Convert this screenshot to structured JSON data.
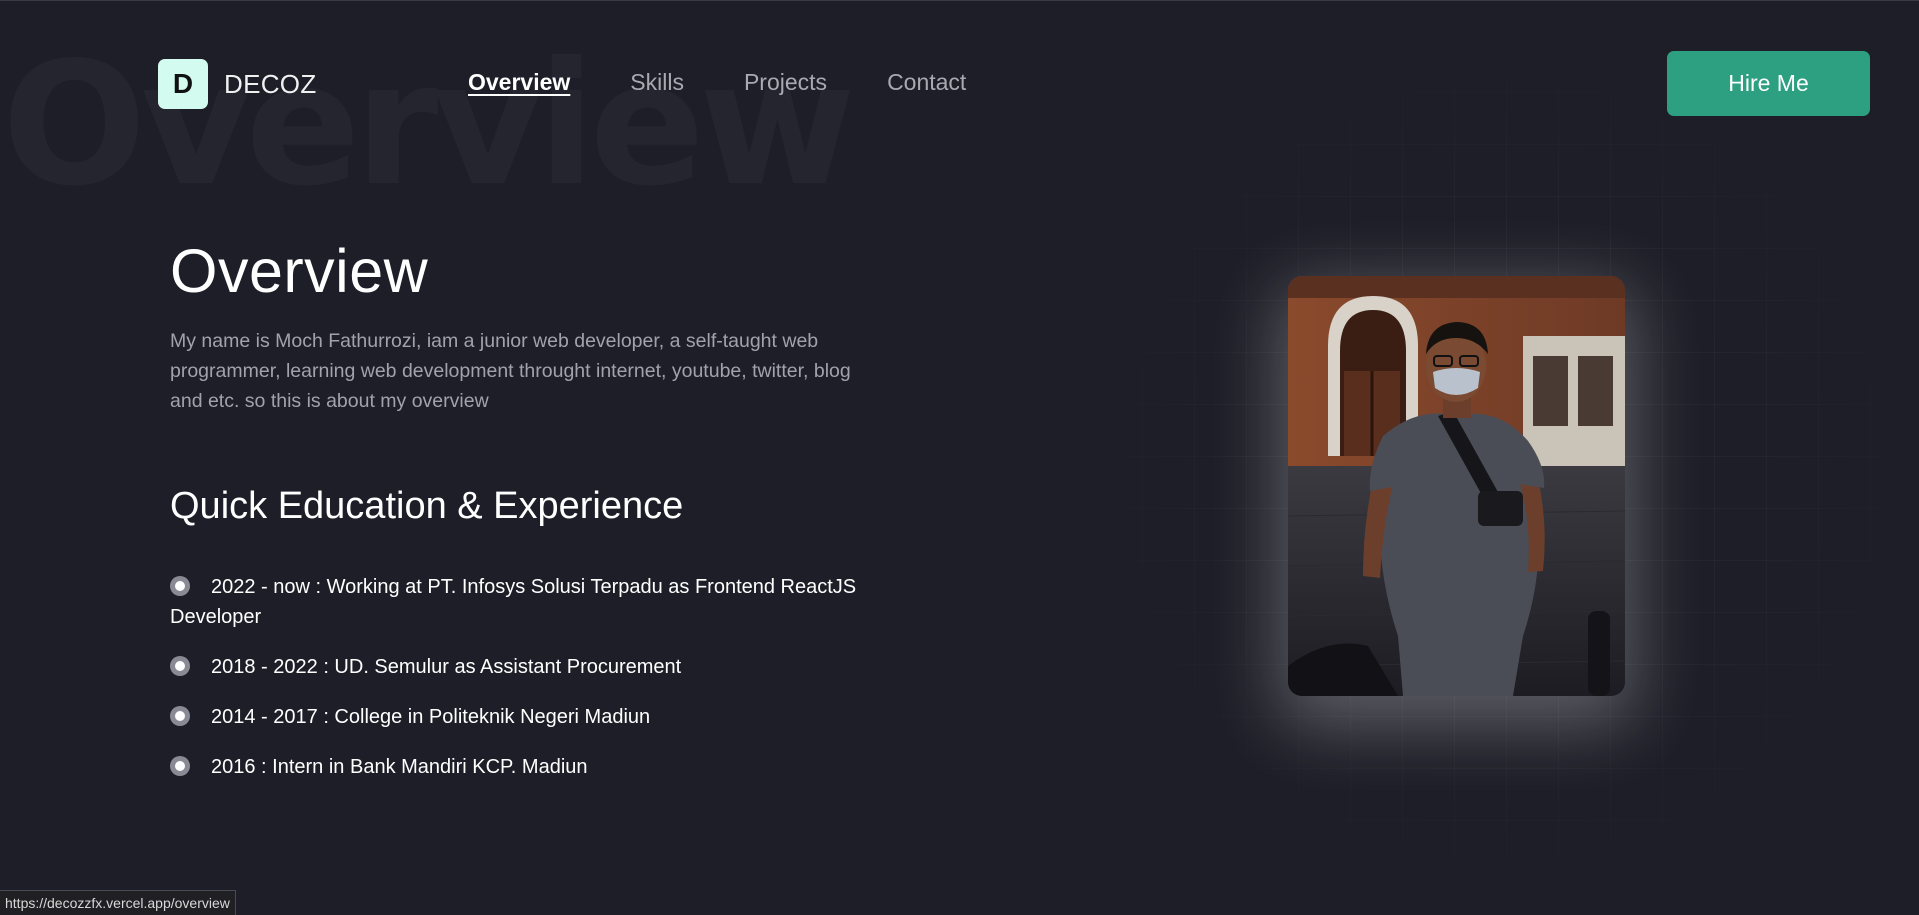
{
  "watermark": "Overview",
  "logo": {
    "letter": "D",
    "name": "DECOZ"
  },
  "nav": {
    "items": [
      {
        "label": "Overview",
        "active": true
      },
      {
        "label": "Skills",
        "active": false
      },
      {
        "label": "Projects",
        "active": false
      },
      {
        "label": "Contact",
        "active": false
      }
    ]
  },
  "header": {
    "hire_label": "Hire Me"
  },
  "main": {
    "title": "Overview",
    "intro": "My name is Moch Fathurrozi, iam a junior web developer, a self-taught web programmer, learning web development throught internet, youtube, twitter, blog and etc. so this is about my overview",
    "subtitle": "Quick Education & Experience",
    "timeline": [
      {
        "text": "2022 - now : Working at PT. Infosys Solusi Terpadu as Frontend ReactJS Developer"
      },
      {
        "text": "2018 - 2022 : UD. Semulur as Assistant Procurement"
      },
      {
        "text": "2014 - 2017 : College in Politeknik Negeri Madiun"
      },
      {
        "text": "2016 : Intern in Bank Mandiri KCP. Madiun"
      }
    ]
  },
  "status_bar": {
    "url": "https://decozzfx.vercel.app/overview"
  },
  "colors": {
    "background": "#1e1e28",
    "accent": "#2ea082",
    "logo_bg": "#d3fbef",
    "muted_text": "#a2a2ad"
  }
}
